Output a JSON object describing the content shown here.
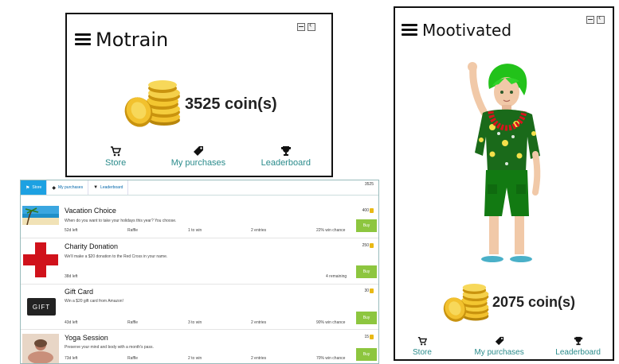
{
  "motrain": {
    "title": "Motrain",
    "coins": "3525 coin(s)",
    "nav": {
      "store": "Store",
      "purchases": "My purchases",
      "leaderboard": "Leaderboard"
    }
  },
  "mootivated": {
    "title": "Mootivated",
    "coins": "2075 coin(s)",
    "nav": {
      "store": "Store",
      "purchases": "My purchases",
      "leaderboard": "Leaderboard"
    }
  },
  "store": {
    "tabs": [
      {
        "label": "Store",
        "icon": "flag-icon"
      },
      {
        "label": "My purchases",
        "icon": "tag-icon"
      },
      {
        "label": "Leaderboard",
        "icon": "trophy-icon"
      }
    ],
    "total": "3525",
    "buy_label": "Buy",
    "items": [
      {
        "title": "Vacation Choice",
        "desc": "When do you want to take your holidays this year? You choose.",
        "price": "400",
        "left": "52d left",
        "type": "Raffle",
        "to_win": "1 to win",
        "entries": "2 entries",
        "chance": "22% win chance"
      },
      {
        "title": "Charity Donation",
        "desc": "We'll make a $20 donation to the Red Cross in your name.",
        "price": "250",
        "left": "38d left",
        "remaining": "4 remaining"
      },
      {
        "title": "Gift Card",
        "desc": "Win a $20 gift card from Amazon!",
        "price": "30",
        "left": "43d left",
        "type": "Raffle",
        "to_win": "3 to win",
        "entries": "2 entries",
        "chance": "90% win chance",
        "thumb_text": "GIFT"
      },
      {
        "title": "Yoga Session",
        "desc": "Preserve your mind and body with a month's pass.",
        "price": "15",
        "left": "73d left",
        "type": "Raffle",
        "to_win": "2 to win",
        "entries": "2 entries",
        "chance": "70% win chance"
      }
    ]
  },
  "colors": {
    "accent": "#1da1e2",
    "buy": "#8dc63f",
    "nav_text": "#2a8b8b",
    "coin": "#e9b916",
    "cross": "#d0121b"
  }
}
